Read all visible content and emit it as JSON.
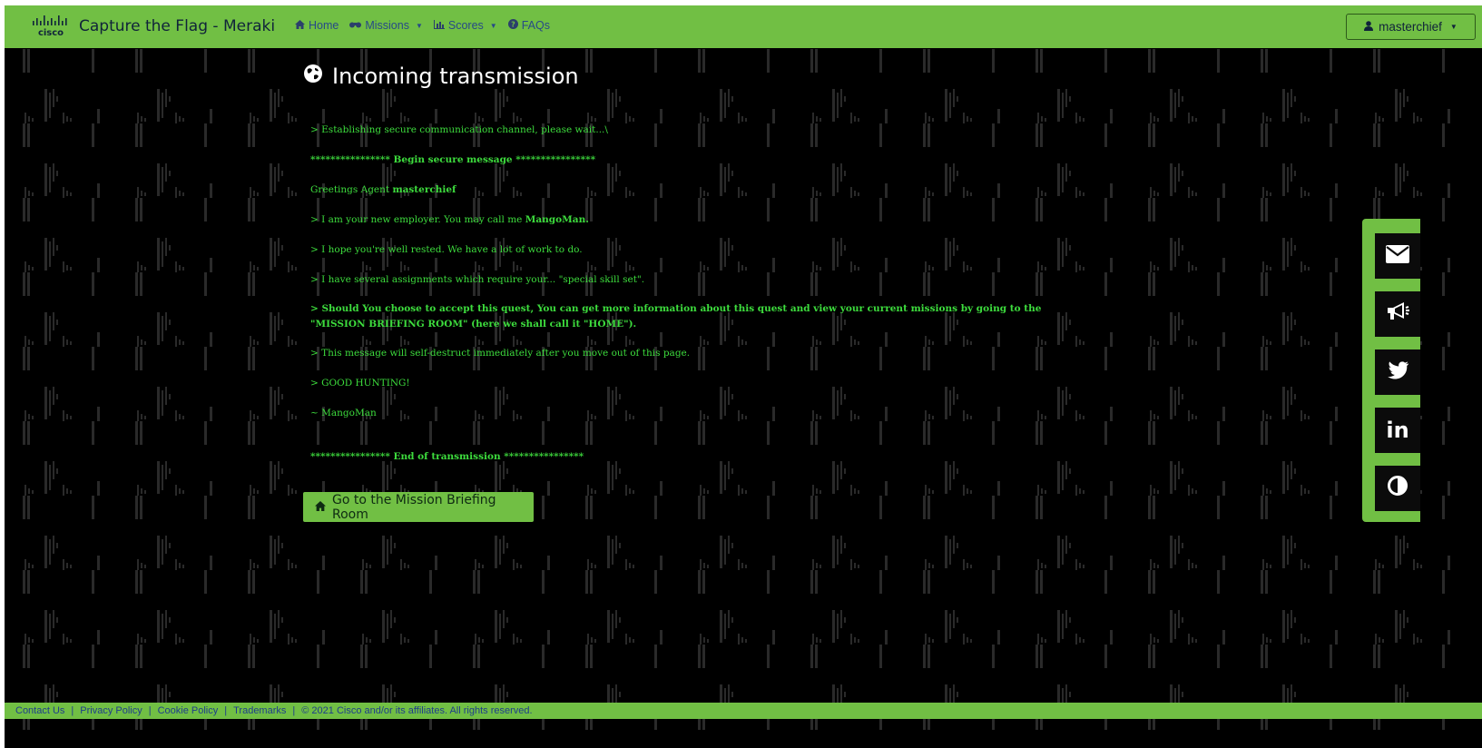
{
  "navbar": {
    "logo_text": "cisco",
    "title": "Capture the Flag - Meraki",
    "links": [
      {
        "label": "Home",
        "icon": "home-icon",
        "dropdown": false
      },
      {
        "label": "Missions",
        "icon": "binoculars-icon",
        "dropdown": true
      },
      {
        "label": "Scores",
        "icon": "bar-chart-icon",
        "dropdown": true
      },
      {
        "label": "FAQs",
        "icon": "question-circle-icon",
        "dropdown": false
      }
    ],
    "user": {
      "name": "masterchief",
      "icon": "user-icon"
    }
  },
  "main": {
    "heading": "Incoming transmission",
    "heading_icon": "globe-icon",
    "lines": [
      {
        "text": "> Establishing secure communication channel, please wait...\\"
      },
      {
        "text": "**************** Begin secure message ****************"
      },
      {
        "prefix": "Greetings Agent ",
        "bold": "masterchief"
      },
      {
        "prefix": "> I am your new employer. You may call me ",
        "bold": "MangoMan."
      },
      {
        "text": "> I hope you're well rested.  We have a lot of work to do."
      },
      {
        "text": "> I have several assignments which require your... \"special skill set\"."
      },
      {
        "text": "> Should You choose to accept this quest, You can get more information about this quest and view your current missions by going to the"
      },
      {
        "text": "\"MISSION BRIEFING ROOM\" (here we shall call it \"HOME\")."
      },
      {
        "text": "> This message will self-destruct immediately after you move out of this page."
      },
      {
        "text": "> GOOD HUNTING!"
      },
      {
        "text": "~ MangoMan"
      },
      {
        "text": "**************** End of transmission ****************"
      }
    ],
    "button_label": "Go to the Mission Briefing Room",
    "button_icon": "home-icon"
  },
  "side_panel": {
    "buttons": [
      {
        "name": "email",
        "icon": "envelope-icon"
      },
      {
        "name": "announce",
        "icon": "megaphone-icon"
      },
      {
        "name": "twitter",
        "icon": "twitter-icon"
      },
      {
        "name": "linkedin",
        "icon": "linkedin-icon",
        "text": "in"
      },
      {
        "name": "contrast",
        "icon": "contrast-icon"
      }
    ]
  },
  "footer": {
    "links": [
      "Contact Us",
      "Privacy Policy",
      "Cookie Policy",
      "Trademarks"
    ],
    "copyright": "© 2021 Cisco and/or its affiliates. All rights reserved."
  },
  "colors": {
    "accent_green": "#71bf44",
    "terminal_green": "#3ddc3d",
    "background": "#000000"
  }
}
